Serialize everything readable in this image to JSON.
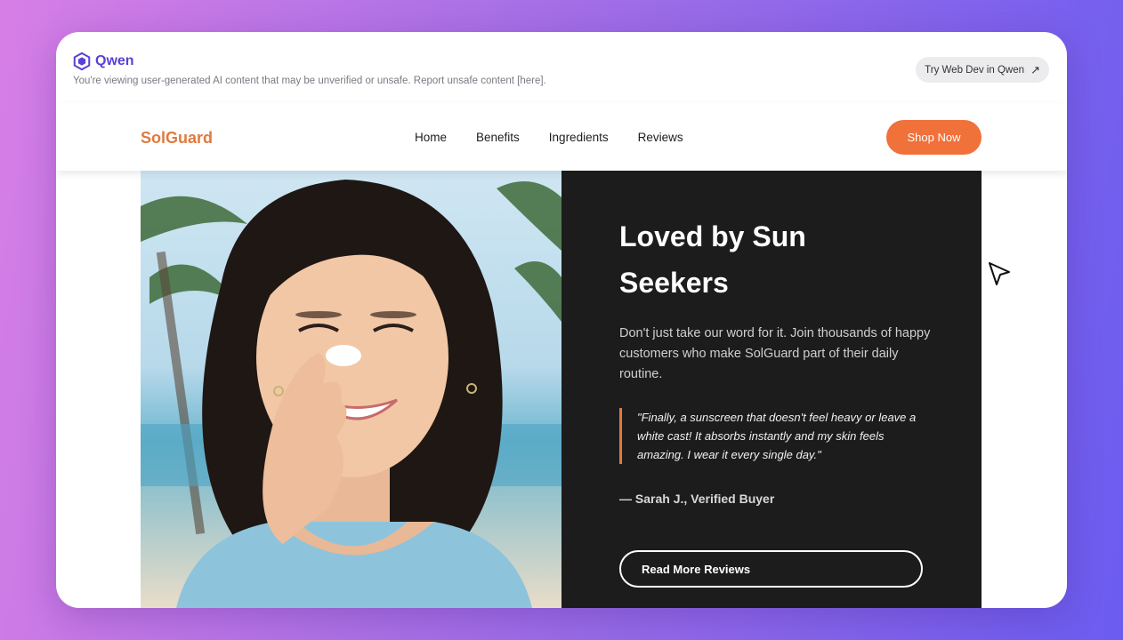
{
  "banner": {
    "brand": "Qwen",
    "disclaimer": "You're viewing user-generated AI content that may be unverified or unsafe. Report unsafe content [here].",
    "try_button": "Try Web Dev in Qwen",
    "try_icon": "arrow-up-right-icon"
  },
  "nav": {
    "brand": "SolGuard",
    "links": [
      "Home",
      "Benefits",
      "Ingredients",
      "Reviews"
    ],
    "cta": "Shop Now"
  },
  "hero": {
    "title": "Loved by Sun Seekers",
    "body": "Don't just take our word for it. Join thousands of happy customers who make SolGuard part of their daily routine.",
    "quote": "\"Finally, a sunscreen that doesn't feel heavy or leave a white cast! It absorbs instantly and my skin feels amazing. I wear it every single day.\"",
    "author": "— Sarah J., Verified Buyer",
    "button": "Read More Reviews"
  },
  "colors": {
    "brand_orange": "#f0713a",
    "panel_dark": "#1c1c1d",
    "qwen_purple": "#5b3fd6"
  }
}
